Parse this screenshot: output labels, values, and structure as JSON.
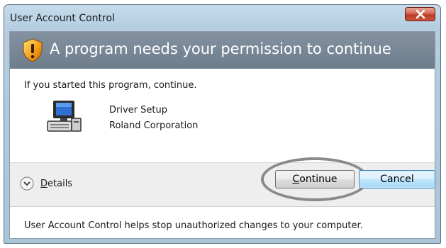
{
  "window": {
    "title": "User Account Control",
    "close_glyph": "X"
  },
  "banner": {
    "icon": "shield-warning-icon",
    "text": "A program needs your permission to continue"
  },
  "prompt": "If you started this program, continue.",
  "program": {
    "icon": "computer-icon",
    "name": "Driver Setup",
    "publisher": "Roland Corporation"
  },
  "actions": {
    "details_underlined": "D",
    "details_rest": "etails",
    "continue_underlined": "C",
    "continue_rest": "ontinue",
    "cancel_label": "Cancel"
  },
  "footer": "User Account Control helps stop unauthorized changes to your computer.",
  "colors": {
    "banner": "#76869a",
    "close_button": "#c9503a",
    "default_button_border": "#3c7fb1"
  }
}
